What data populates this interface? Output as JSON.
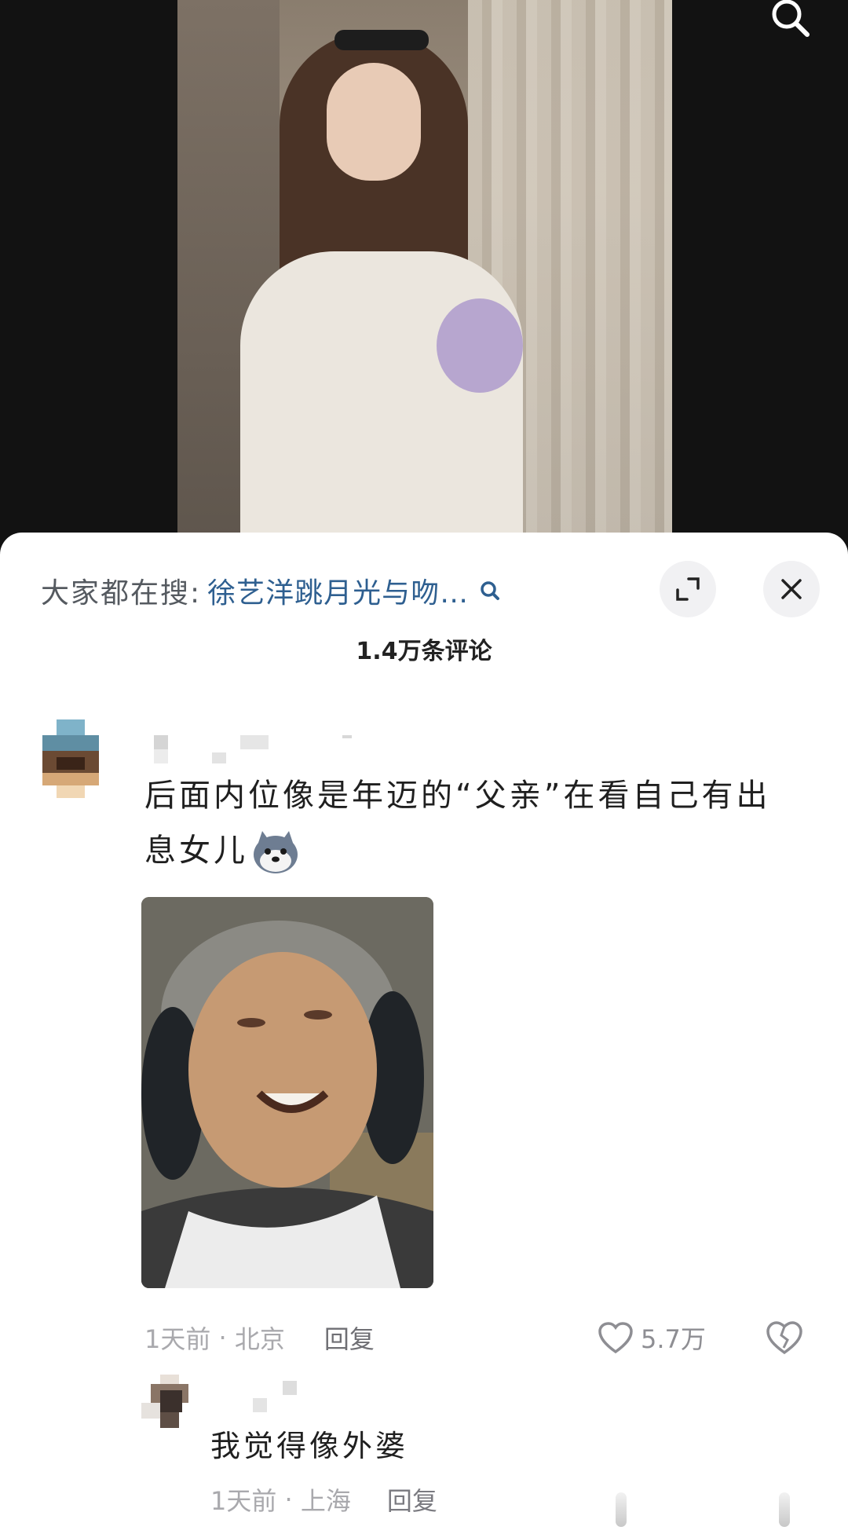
{
  "search_suggestion": {
    "prefix": "大家都在搜:",
    "term": "徐艺洋跳月光与吻…"
  },
  "comments_header": {
    "count_label": "1.4万条评论"
  },
  "comment": {
    "text": "后面内位像是年迈的“父亲”在看自己有出息女儿",
    "time": "1天前",
    "location": "北京",
    "reply_label": "回复",
    "like_count": "5.7万"
  },
  "reply": {
    "text": "我觉得像外婆",
    "time": "1天前",
    "location": "上海",
    "reply_label": "回复"
  },
  "colors": {
    "accent_link": "#2e5f90",
    "meta_gray": "#a9a9ad"
  },
  "icons": [
    "search-icon",
    "expand-icon",
    "close-icon",
    "heart-icon",
    "broken-heart-icon",
    "wolf-emoji"
  ]
}
